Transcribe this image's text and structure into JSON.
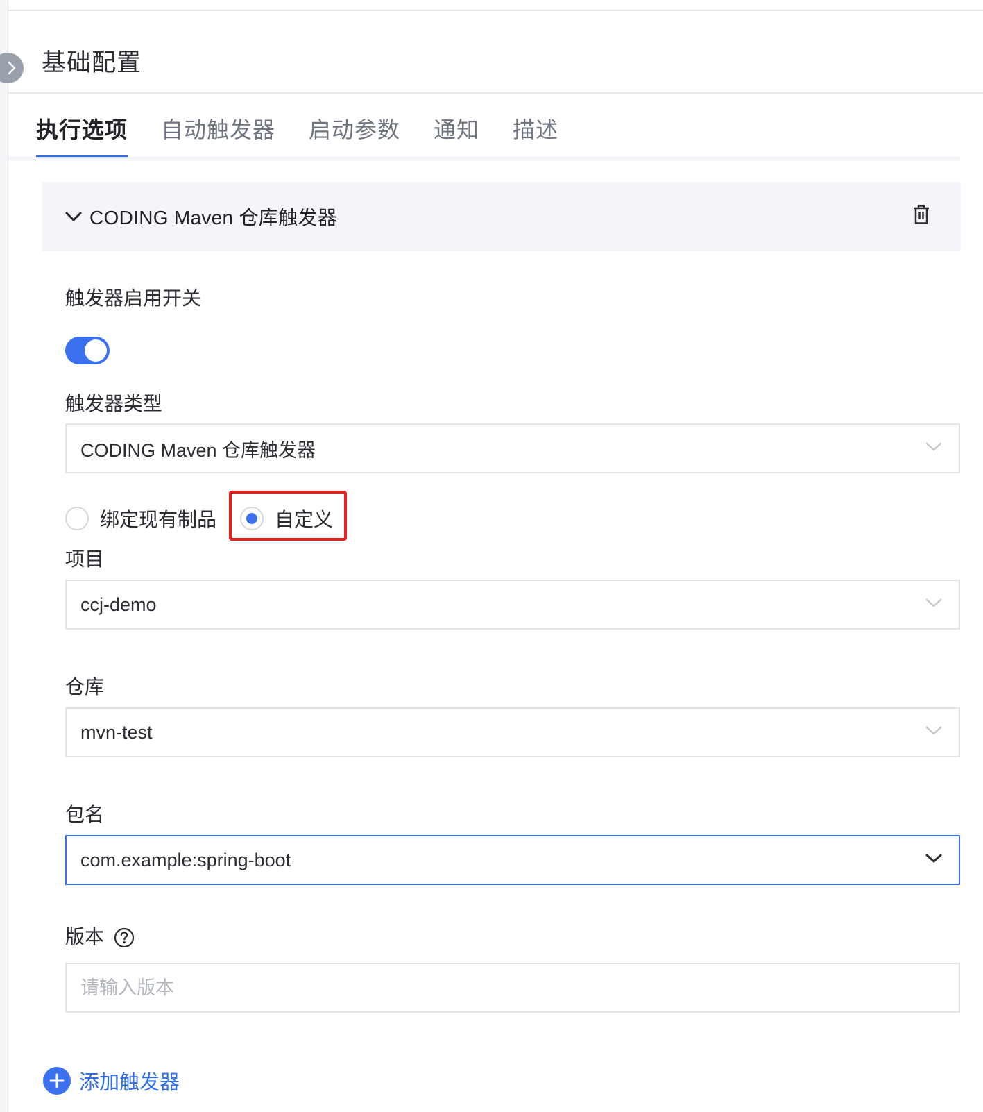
{
  "panel": {
    "title": "基础配置"
  },
  "tabs": [
    {
      "label": "执行选项",
      "active": true
    },
    {
      "label": "自动触发器",
      "active": false
    },
    {
      "label": "启动参数",
      "active": false
    },
    {
      "label": "通知",
      "active": false
    },
    {
      "label": "描述",
      "active": false
    }
  ],
  "trigger": {
    "header_title": "CODING Maven 仓库触发器",
    "enable_label": "触发器启用开关",
    "enabled": true,
    "type_label": "触发器类型",
    "type_value": "CODING Maven 仓库触发器",
    "source_options": [
      {
        "label": "绑定现有制品",
        "checked": false
      },
      {
        "label": "自定义",
        "checked": true
      }
    ],
    "project_label": "项目",
    "project_value": "ccj-demo",
    "repo_label": "仓库",
    "repo_value": "mvn-test",
    "package_label": "包名",
    "package_value": "com.example:spring-boot",
    "version_label": "版本",
    "version_placeholder": "请输入版本"
  },
  "add_trigger_label": "添加触发器",
  "colors": {
    "accent": "#3b71ef",
    "highlight": "#e8201e"
  }
}
